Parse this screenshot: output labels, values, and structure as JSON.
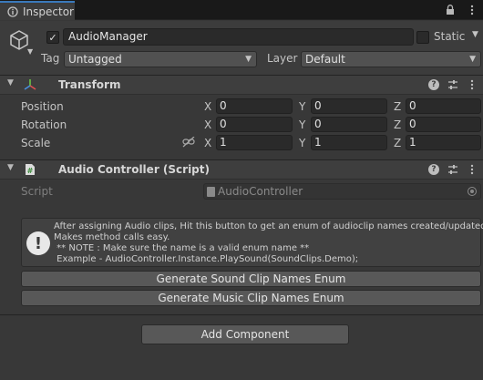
{
  "tab": {
    "title": "Inspector"
  },
  "gameobject": {
    "active": true,
    "name": "AudioManager",
    "static_label": "Static",
    "static": false,
    "tag_label": "Tag",
    "tag_value": "Untagged",
    "layer_label": "Layer",
    "layer_value": "Default"
  },
  "transform": {
    "title": "Transform",
    "rows": [
      {
        "label": "Position",
        "x": "0",
        "y": "0",
        "z": "0"
      },
      {
        "label": "Rotation",
        "x": "0",
        "y": "0",
        "z": "0"
      },
      {
        "label": "Scale",
        "x": "1",
        "y": "1",
        "z": "1"
      }
    ],
    "axes": {
      "x": "X",
      "y": "Y",
      "z": "Z"
    }
  },
  "audio_controller": {
    "title": "Audio Controller (Script)",
    "script_label": "Script",
    "script_value": "AudioController",
    "help_lines": [
      "After assigning Audio clips, Hit this button to get an enum of audioclip names created/updated.",
      "Makes method calls easy.",
      " ** NOTE : Make sure the name is a valid enum name **",
      " Example - AudioController.Instance.PlaySound(SoundClips.Demo);"
    ],
    "button_sound": "Generate Sound Clip Names Enum",
    "button_music": "Generate Music Clip Names Enum"
  },
  "add_component": "Add Component",
  "icons": {
    "tab": "inspector-icon",
    "lock": "lock-icon",
    "kebab": "kebab-menu-icon",
    "gameobject": "cube-icon",
    "transform": "transform-axes-icon",
    "script": "csharp-script-icon",
    "help": "help-icon",
    "presets": "presets-icon",
    "component_menu": "component-menu-icon",
    "scale_link": "scale-link-icon",
    "info": "info-icon"
  },
  "colors": {
    "background": "#383838",
    "tab_accent": "#3a79bb",
    "field": "#2a2a2a",
    "button": "#585858"
  }
}
